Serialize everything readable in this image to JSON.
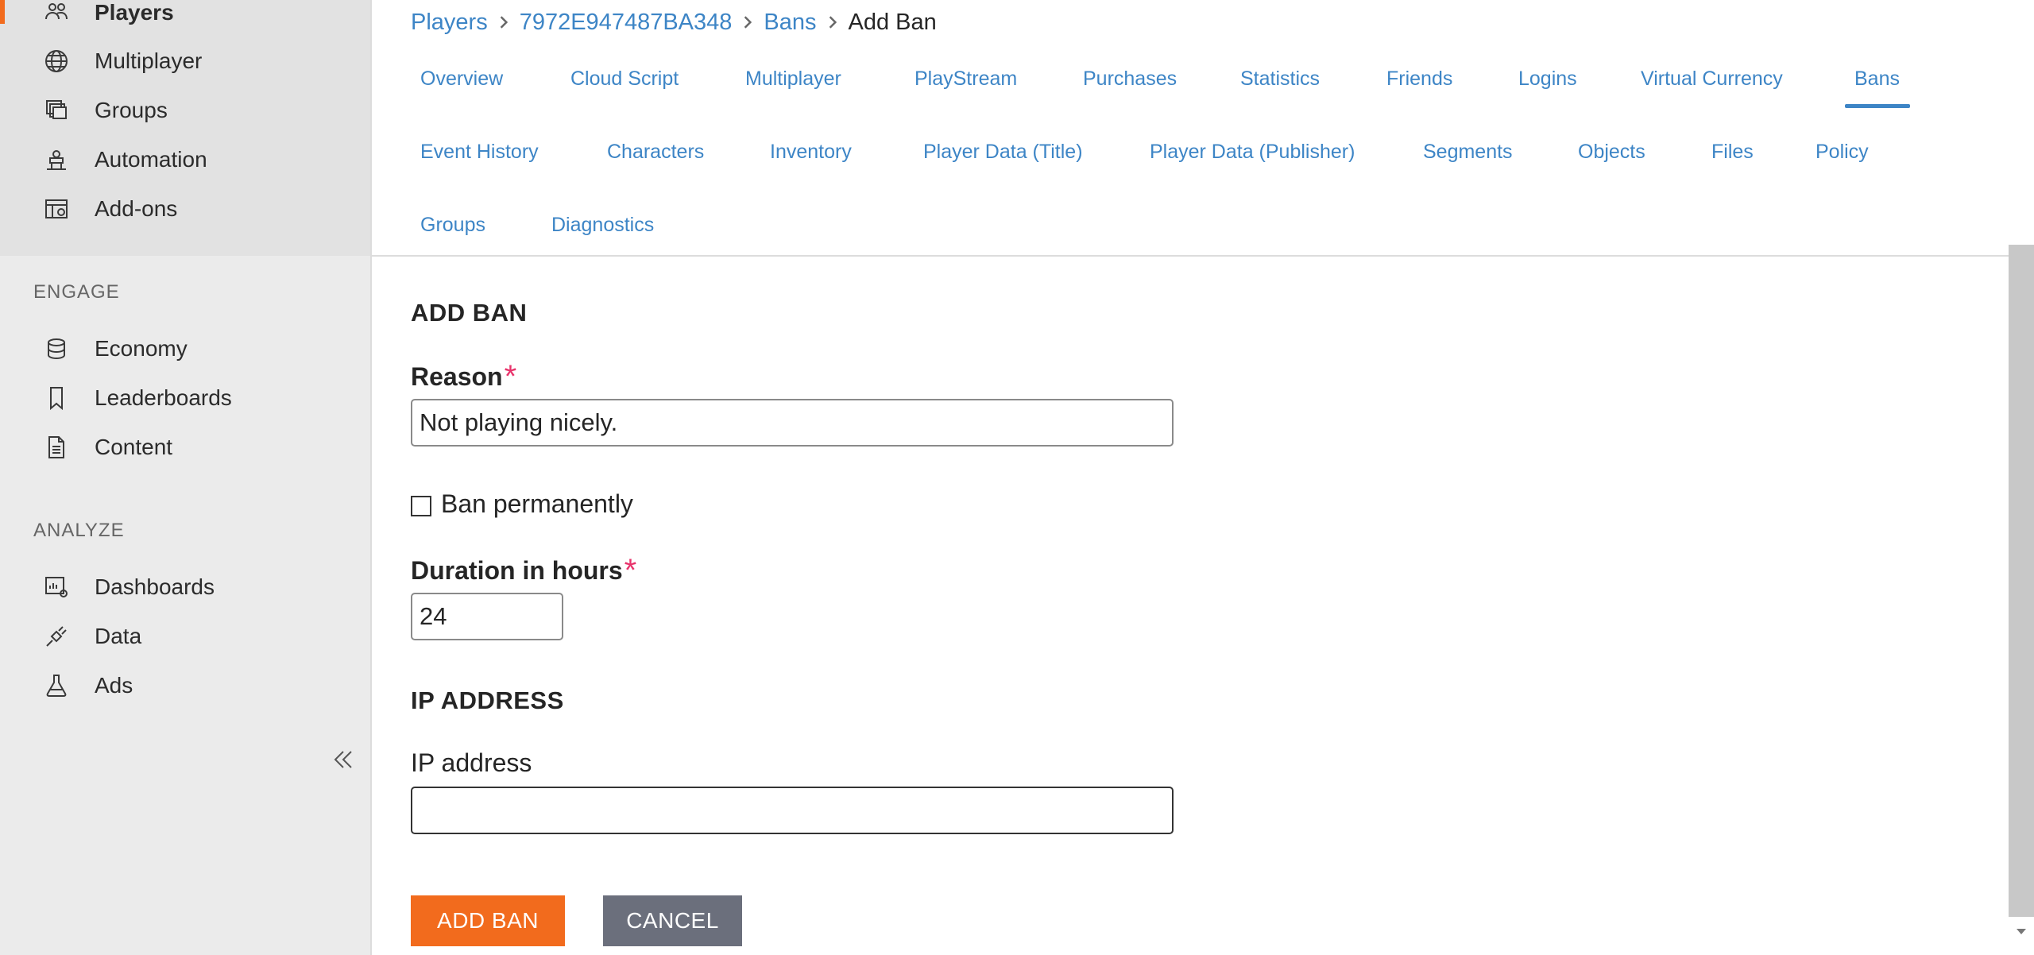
{
  "sidebar": {
    "top_items": [
      {
        "label": "Players",
        "icon": "players-icon",
        "active": true
      },
      {
        "label": "Multiplayer",
        "icon": "globe-icon"
      },
      {
        "label": "Groups",
        "icon": "groups-icon"
      },
      {
        "label": "Automation",
        "icon": "automation-icon"
      },
      {
        "label": "Add-ons",
        "icon": "add-ons-icon"
      }
    ],
    "engage_header": "ENGAGE",
    "engage_items": [
      {
        "label": "Economy",
        "icon": "economy-icon"
      },
      {
        "label": "Leaderboards",
        "icon": "bookmark-icon"
      },
      {
        "label": "Content",
        "icon": "document-icon"
      }
    ],
    "analyze_header": "ANALYZE",
    "analyze_items": [
      {
        "label": "Dashboards",
        "icon": "dashboard-icon"
      },
      {
        "label": "Data",
        "icon": "plug-icon"
      },
      {
        "label": "Ads",
        "icon": "flask-icon"
      }
    ],
    "collapse_icon": "double-chevron-left-icon"
  },
  "breadcrumb": {
    "items": [
      "Players",
      "7972E947487BA348",
      "Bans",
      "Add Ban"
    ]
  },
  "tabs": {
    "row1": [
      "Overview",
      "Cloud Script",
      "Multiplayer",
      "PlayStream",
      "Purchases",
      "Statistics",
      "Friends",
      "Logins",
      "Virtual Currency",
      "Bans"
    ],
    "row2": [
      "Event History",
      "Characters",
      "Inventory",
      "Player Data (Title)",
      "Player Data (Publisher)",
      "Segments",
      "Objects",
      "Files",
      "Policy"
    ],
    "row3": [
      "Groups",
      "Diagnostics"
    ],
    "active": "Bans",
    "accent_color": "#3d85c6"
  },
  "form": {
    "section_title": "ADD BAN",
    "reason_label": "Reason",
    "reason_value": "Not playing nicely.",
    "required_mark": "*",
    "ban_permanently_label": "Ban permanently",
    "ban_permanently_checked": false,
    "duration_label": "Duration in hours",
    "duration_value": "24",
    "ip_section_title": "IP ADDRESS",
    "ip_label": "IP address",
    "ip_value": "",
    "add_button": "ADD BAN",
    "cancel_button": "CANCEL",
    "primary_color": "#f26b1d",
    "secondary_color": "#6b6f7c"
  }
}
